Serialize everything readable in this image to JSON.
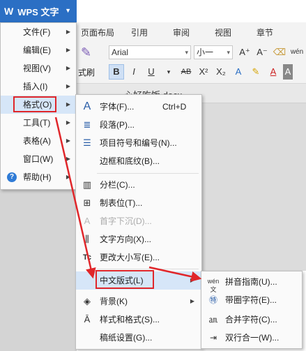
{
  "app": {
    "title": "WPS 文字"
  },
  "ribbon": {
    "tabs": [
      "页面布局",
      "引用",
      "审阅",
      "视图",
      "章节"
    ],
    "font": "Arial",
    "size": "小一",
    "partial_label": "式刷"
  },
  "document": {
    "tab_name": "心好吃饭.docx"
  },
  "main_menu": {
    "items": [
      {
        "label": "文件(F)"
      },
      {
        "label": "编辑(E)"
      },
      {
        "label": "视图(V)"
      },
      {
        "label": "插入(I)"
      },
      {
        "label": "格式(O)"
      },
      {
        "label": "工具(T)"
      },
      {
        "label": "表格(A)"
      },
      {
        "label": "窗口(W)"
      },
      {
        "label": "帮助(H)"
      }
    ]
  },
  "format_menu": {
    "items": [
      {
        "label": "字体(F)...",
        "shortcut": "Ctrl+D"
      },
      {
        "label": "段落(P)..."
      },
      {
        "label": "项目符号和编号(N)..."
      },
      {
        "label": "边框和底纹(B)..."
      },
      {
        "label": "分栏(C)..."
      },
      {
        "label": "制表位(T)..."
      },
      {
        "label": "首字下沉(D)..."
      },
      {
        "label": "文字方向(X)..."
      },
      {
        "label": "更改大小写(E)..."
      },
      {
        "label": "中文版式(L)"
      },
      {
        "label": "背景(K)"
      },
      {
        "label": "样式和格式(S)..."
      },
      {
        "label": "稿纸设置(G)..."
      }
    ]
  },
  "chinese_layout_menu": {
    "items": [
      {
        "label": "拼音指南(U)..."
      },
      {
        "label": "带圈字符(E)..."
      },
      {
        "label": "合并字符(C)..."
      },
      {
        "label": "双行合一(W)..."
      }
    ]
  },
  "colors": {
    "accent": "#2b6fc4",
    "highlight": "#d6e6f8",
    "annotation": "#e0262a"
  }
}
